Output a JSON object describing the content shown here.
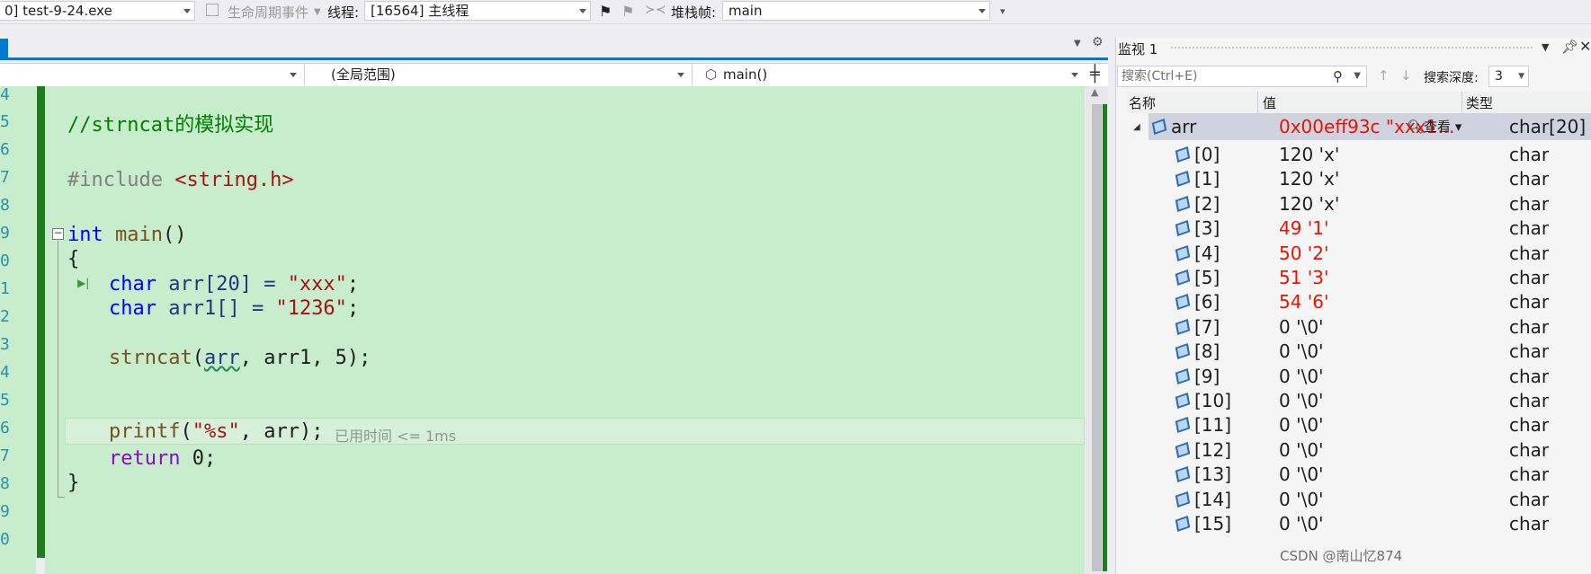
{
  "toolbar": {
    "process": "0] test-9-24.exe",
    "lifecycle_events": "生命周期事件",
    "thread_label": "线程:",
    "thread_value": "[16564] 主线程",
    "stackframe_label": "堆栈帧:",
    "stackframe_value": "main"
  },
  "nav": {
    "project_dropdown": "",
    "scope_dropdown": "(全局范围)",
    "function_dropdown": "main()"
  },
  "code": {
    "line_numbers": [
      "4",
      "5",
      "6",
      "7",
      "8",
      "9",
      "0",
      "1",
      "2",
      "3",
      "4",
      "5",
      "6",
      "7",
      "8",
      "9",
      "0"
    ],
    "comment": "//strncat的模拟实现",
    "include_directive": "#include",
    "include_header": "<string.h>",
    "kw_int": "int",
    "fn_main": "main",
    "paren_open_close": "()",
    "brace_open": "{",
    "kw_char": "char",
    "line_arr_decl_name": "arr[20] = ",
    "line_arr_decl_value": "\"xxx\"",
    "semicolon": ";",
    "line_arr1_decl_name": "arr1[] = ",
    "line_arr1_decl_value": "\"1236\"",
    "fn_strncat": "strncat",
    "strncat_args_a": "arr",
    "strncat_args_b": ", arr1, 5);",
    "fn_printf": "printf",
    "printf_fmt": "\"%s\"",
    "printf_rest": ", arr);",
    "elapsed_hint": "已用时间 <= 1ms",
    "kw_return": "return",
    "return_value": " 0;",
    "brace_close": "}"
  },
  "watch": {
    "title": "监视 1",
    "search_placeholder": "搜索(Ctrl+E)",
    "search_depth_label": "搜索深度:",
    "search_depth_value": "3",
    "columns": {
      "name": "名称",
      "value": "值",
      "type": "类型"
    },
    "root": {
      "name": "arr",
      "value": "0x00eff93c \"xxx1...",
      "view": "查看",
      "type": "char[20]"
    },
    "items": [
      {
        "name": "[0]",
        "value": "120 'x'",
        "type": "char",
        "changed": false
      },
      {
        "name": "[1]",
        "value": "120 'x'",
        "type": "char",
        "changed": false
      },
      {
        "name": "[2]",
        "value": "120 'x'",
        "type": "char",
        "changed": false
      },
      {
        "name": "[3]",
        "value": "49 '1'",
        "type": "char",
        "changed": true
      },
      {
        "name": "[4]",
        "value": "50 '2'",
        "type": "char",
        "changed": true
      },
      {
        "name": "[5]",
        "value": "51 '3'",
        "type": "char",
        "changed": true
      },
      {
        "name": "[6]",
        "value": "54 '6'",
        "type": "char",
        "changed": true
      },
      {
        "name": "[7]",
        "value": "0 '\\0'",
        "type": "char",
        "changed": false
      },
      {
        "name": "[8]",
        "value": "0 '\\0'",
        "type": "char",
        "changed": false
      },
      {
        "name": "[9]",
        "value": "0 '\\0'",
        "type": "char",
        "changed": false
      },
      {
        "name": "[10]",
        "value": "0 '\\0'",
        "type": "char",
        "changed": false
      },
      {
        "name": "[11]",
        "value": "0 '\\0'",
        "type": "char",
        "changed": false
      },
      {
        "name": "[12]",
        "value": "0 '\\0'",
        "type": "char",
        "changed": false
      },
      {
        "name": "[13]",
        "value": "0 '\\0'",
        "type": "char",
        "changed": false
      },
      {
        "name": "[14]",
        "value": "0 '\\0'",
        "type": "char",
        "changed": false
      },
      {
        "name": "[15]",
        "value": "0 '\\0'",
        "type": "char",
        "changed": false
      }
    ]
  },
  "watermark": "CSDN @南山忆874",
  "colors": {
    "changed_value": "#e51400",
    "editor_bg": "#c7edcc"
  }
}
